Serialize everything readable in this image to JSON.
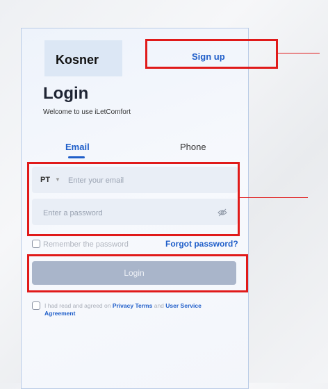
{
  "brand": "Kosner",
  "header": {
    "signup_label": "Sign up"
  },
  "login": {
    "title": "Login",
    "welcome": "Welcome to use iLetComfort"
  },
  "tabs": [
    {
      "label": "Email",
      "active": true
    },
    {
      "label": "Phone",
      "active": false
    }
  ],
  "form": {
    "country_code": "PT",
    "email_placeholder": "Enter your email",
    "password_placeholder": "Enter a password",
    "remember_label": "Remember the password",
    "forgot_label": "Forgot password?",
    "login_button": "Login"
  },
  "agreement": {
    "prefix": "I had read and agreed on",
    "privacy": "Privacy Terms",
    "and": "and",
    "service": "User Service Agreement"
  },
  "icons": {
    "password_toggle": "eye-slash-icon",
    "country_dropdown": "caret-down-icon"
  },
  "colors": {
    "accent": "#1f5ec9",
    "highlight": "#e01a1a",
    "button_disabled": "#a9b5ca"
  }
}
